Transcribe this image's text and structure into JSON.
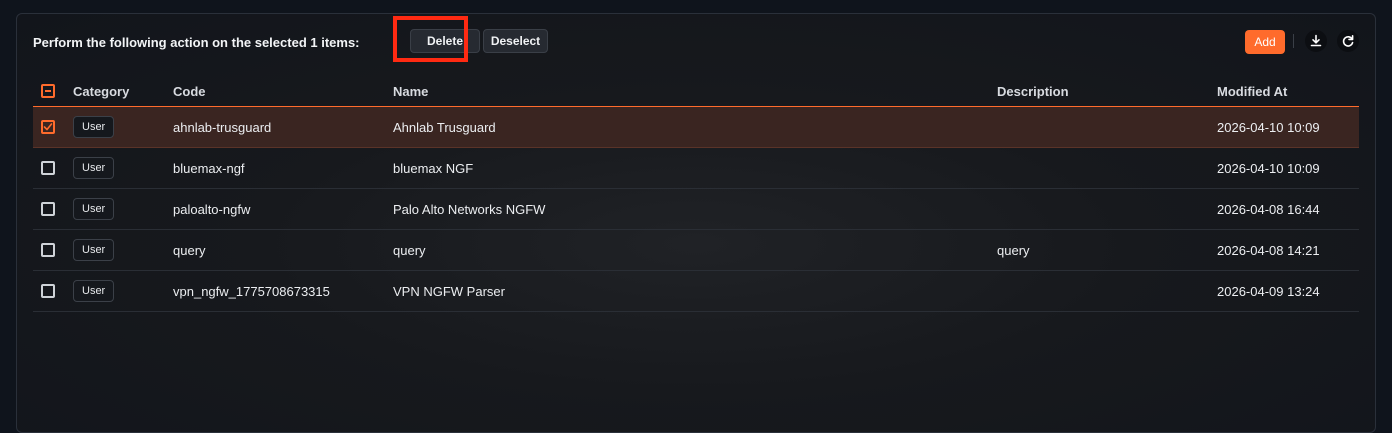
{
  "toolbar": {
    "action_text": "Perform the following action on the selected 1 items:",
    "delete_label": "Delete",
    "deselect_label": "Deselect",
    "add_label": "Add",
    "download_icon": "download-icon",
    "refresh_icon": "refresh-icon"
  },
  "colors": {
    "accent": "#ff6b2c",
    "highlight_box": "#ff2a12",
    "selected_row": "#3a2521"
  },
  "table": {
    "headers": {
      "category": "Category",
      "code": "Code",
      "name": "Name",
      "description": "Description",
      "modified_at": "Modified At"
    },
    "rows": [
      {
        "selected": true,
        "category": "User",
        "code": "ahnlab-trusguard",
        "name": "Ahnlab Trusguard",
        "description": "",
        "modified_at": "2026-04-10 10:09"
      },
      {
        "selected": false,
        "category": "User",
        "code": "bluemax-ngf",
        "name": "bluemax NGF",
        "description": "",
        "modified_at": "2026-04-10 10:09"
      },
      {
        "selected": false,
        "category": "User",
        "code": "paloalto-ngfw",
        "name": "Palo Alto Networks NGFW",
        "description": "",
        "modified_at": "2026-04-08 16:44"
      },
      {
        "selected": false,
        "category": "User",
        "code": "query",
        "name": "query",
        "description": "query",
        "modified_at": "2026-04-08 14:21"
      },
      {
        "selected": false,
        "category": "User",
        "code": "vpn_ngfw_1775708673315",
        "name": "VPN NGFW Parser",
        "description": "",
        "modified_at": "2026-04-09 13:24"
      }
    ]
  }
}
